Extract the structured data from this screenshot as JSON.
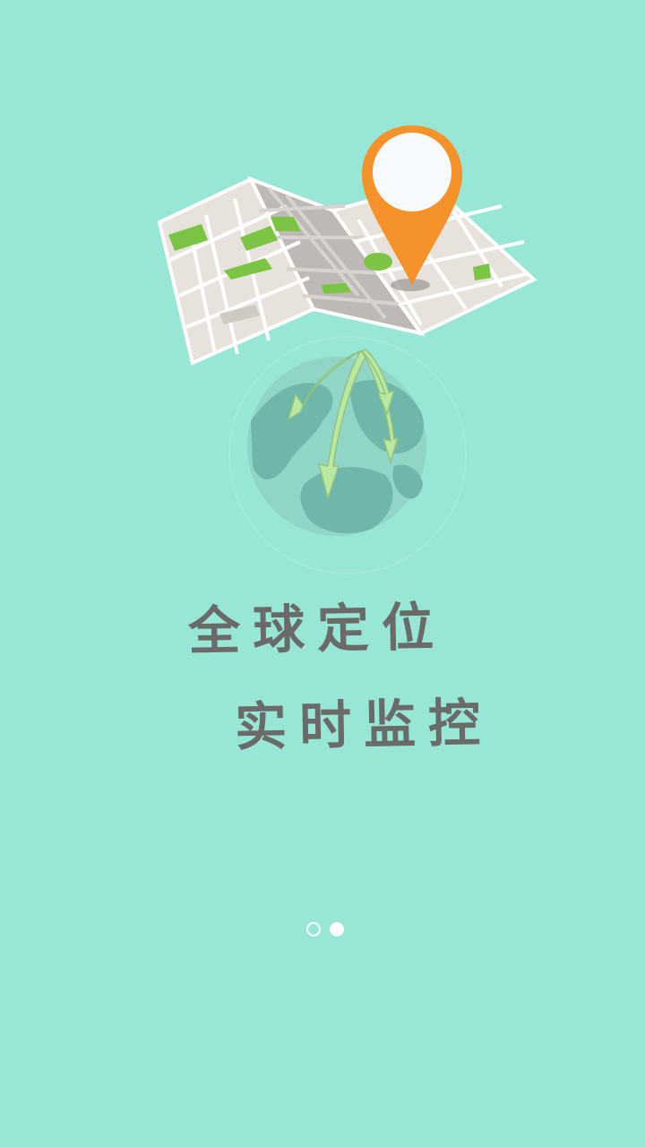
{
  "slogan": {
    "line1": "全球定位",
    "line2": "实时监控"
  },
  "pager": {
    "current_page": 2,
    "total_pages": 2
  },
  "colors": {
    "background": "#98e6d5",
    "pin": "#f5922a",
    "text": "#6a6a6a",
    "globe": "#6fb7ab",
    "arrow": "#b9e9a0"
  },
  "icons": {
    "map": "folded-map-icon",
    "pin": "location-pin-icon",
    "globe": "globe-icon"
  }
}
